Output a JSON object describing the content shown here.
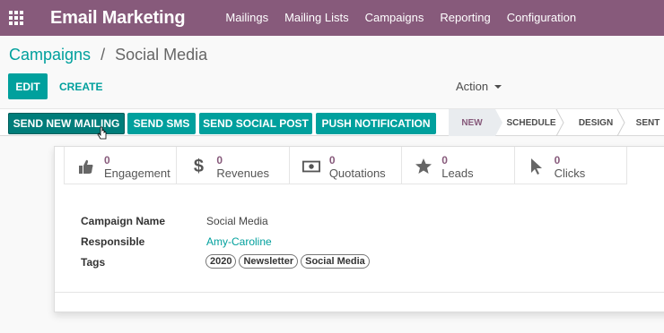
{
  "navbar": {
    "apps_icon": "apps-grid-icon",
    "app_title": "Email Marketing",
    "menu": [
      "Mailings",
      "Mailing Lists",
      "Campaigns",
      "Reporting",
      "Configuration"
    ]
  },
  "breadcrumb": {
    "parent": "Campaigns",
    "separator": "/",
    "current": "Social Media"
  },
  "control": {
    "edit_label": "EDIT",
    "create_label": "CREATE",
    "action_label": "Action"
  },
  "header_buttons": [
    "SEND NEW MAILING",
    "SEND SMS",
    "SEND SOCIAL POST",
    "PUSH NOTIFICATION"
  ],
  "stages": {
    "items": [
      "NEW",
      "SCHEDULE",
      "DESIGN",
      "SENT"
    ],
    "current": "NEW"
  },
  "stats": [
    {
      "icon": "thumbs-up-icon",
      "value": "0",
      "label": "Engagement"
    },
    {
      "icon": "dollar-icon",
      "value": "0",
      "label": "Revenues"
    },
    {
      "icon": "money-bill-icon",
      "value": "0",
      "label": "Quotations"
    },
    {
      "icon": "star-icon",
      "value": "0",
      "label": "Leads"
    },
    {
      "icon": "cursor-icon",
      "value": "0",
      "label": "Clicks"
    }
  ],
  "form": {
    "campaign_name_label": "Campaign Name",
    "campaign_name_value": "Social Media",
    "responsible_label": "Responsible",
    "responsible_value": "Amy-Caroline",
    "tags_label": "Tags",
    "tags": [
      "2020",
      "Newsletter",
      "Social Media"
    ]
  },
  "colors": {
    "brand": "#875a7b",
    "accent": "#00a09d"
  }
}
